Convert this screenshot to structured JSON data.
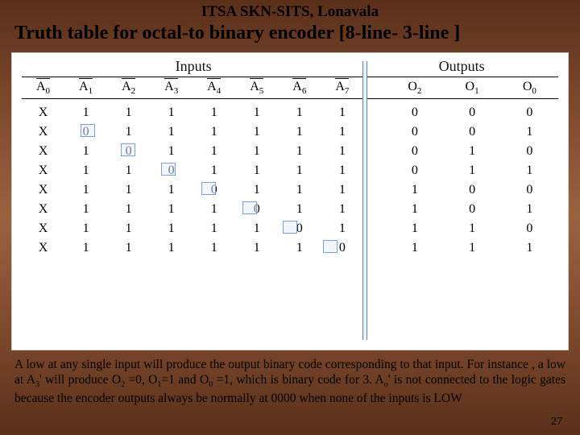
{
  "org": "ITSA SKN-SITS, Lonavala",
  "title": "Truth table for octal-to binary encoder [8-line- 3-line ]",
  "section_labels": {
    "inputs": "Inputs",
    "outputs": "Outputs"
  },
  "headers": {
    "inputs": [
      "A",
      "A",
      "A",
      "A",
      "A",
      "A",
      "A",
      "A"
    ],
    "in_sub": [
      "0",
      "1",
      "2",
      "3",
      "4",
      "5",
      "6",
      "7"
    ],
    "outputs": [
      "O",
      "O",
      "O"
    ],
    "out_sub": [
      "2",
      "1",
      "0"
    ]
  },
  "rows": [
    {
      "in": [
        "X",
        "1",
        "1",
        "1",
        "1",
        "1",
        "1",
        "1"
      ],
      "out": [
        "0",
        "0",
        "0"
      ]
    },
    {
      "in": [
        "X",
        "0",
        "1",
        "1",
        "1",
        "1",
        "1",
        "1"
      ],
      "out": [
        "0",
        "0",
        "1"
      ]
    },
    {
      "in": [
        "X",
        "1",
        "0",
        "1",
        "1",
        "1",
        "1",
        "1"
      ],
      "out": [
        "0",
        "1",
        "0"
      ]
    },
    {
      "in": [
        "X",
        "1",
        "1",
        "0",
        "1",
        "1",
        "1",
        "1"
      ],
      "out": [
        "0",
        "1",
        "1"
      ]
    },
    {
      "in": [
        "X",
        "1",
        "1",
        "1",
        "0",
        "1",
        "1",
        "1"
      ],
      "out": [
        "1",
        "0",
        "0"
      ]
    },
    {
      "in": [
        "X",
        "1",
        "1",
        "1",
        "1",
        "0",
        "1",
        "1"
      ],
      "out": [
        "1",
        "0",
        "1"
      ]
    },
    {
      "in": [
        "X",
        "1",
        "1",
        "1",
        "1",
        "1",
        "0",
        "1"
      ],
      "out": [
        "1",
        "1",
        "0"
      ]
    },
    {
      "in": [
        "X",
        "1",
        "1",
        "1",
        "1",
        "1",
        "1",
        "0"
      ],
      "out": [
        "1",
        "1",
        "1"
      ]
    }
  ],
  "caption_parts": {
    "p1": "A low at any single input will produce the output binary code corresponding to that input. For instance , a low at A",
    "s1": "3",
    "p2": "' will produce O",
    "s2": "2",
    "p3": " =0, O",
    "s3": "1",
    "p4": "=1 and O",
    "s4": "0",
    "p5": " =1, which is binary code for 3. A",
    "s5": "o",
    "p6": "' is not connected to the logic gates because the encoder outputs always be normally at 0000 when none of the inputs is LOW"
  },
  "page_number": "27",
  "chart_data": {
    "type": "table",
    "title": "Truth table for octal-to binary encoder (8-line to 3-line)",
    "input_columns": [
      "A0'",
      "A1'",
      "A2'",
      "A3'",
      "A4'",
      "A5'",
      "A6'",
      "A7'"
    ],
    "output_columns": [
      "O2",
      "O1",
      "O0"
    ],
    "rows": [
      {
        "inputs": [
          "X",
          "1",
          "1",
          "1",
          "1",
          "1",
          "1",
          "1"
        ],
        "outputs": [
          "0",
          "0",
          "0"
        ]
      },
      {
        "inputs": [
          "X",
          "0",
          "1",
          "1",
          "1",
          "1",
          "1",
          "1"
        ],
        "outputs": [
          "0",
          "0",
          "1"
        ]
      },
      {
        "inputs": [
          "X",
          "1",
          "0",
          "1",
          "1",
          "1",
          "1",
          "1"
        ],
        "outputs": [
          "0",
          "1",
          "0"
        ]
      },
      {
        "inputs": [
          "X",
          "1",
          "1",
          "0",
          "1",
          "1",
          "1",
          "1"
        ],
        "outputs": [
          "0",
          "1",
          "1"
        ]
      },
      {
        "inputs": [
          "X",
          "1",
          "1",
          "1",
          "0",
          "1",
          "1",
          "1"
        ],
        "outputs": [
          "1",
          "0",
          "0"
        ]
      },
      {
        "inputs": [
          "X",
          "1",
          "1",
          "1",
          "1",
          "0",
          "1",
          "1"
        ],
        "outputs": [
          "1",
          "0",
          "1"
        ]
      },
      {
        "inputs": [
          "X",
          "1",
          "1",
          "1",
          "1",
          "1",
          "0",
          "1"
        ],
        "outputs": [
          "1",
          "1",
          "0"
        ]
      },
      {
        "inputs": [
          "X",
          "1",
          "1",
          "1",
          "1",
          "1",
          "1",
          "0"
        ],
        "outputs": [
          "1",
          "1",
          "1"
        ]
      }
    ]
  }
}
